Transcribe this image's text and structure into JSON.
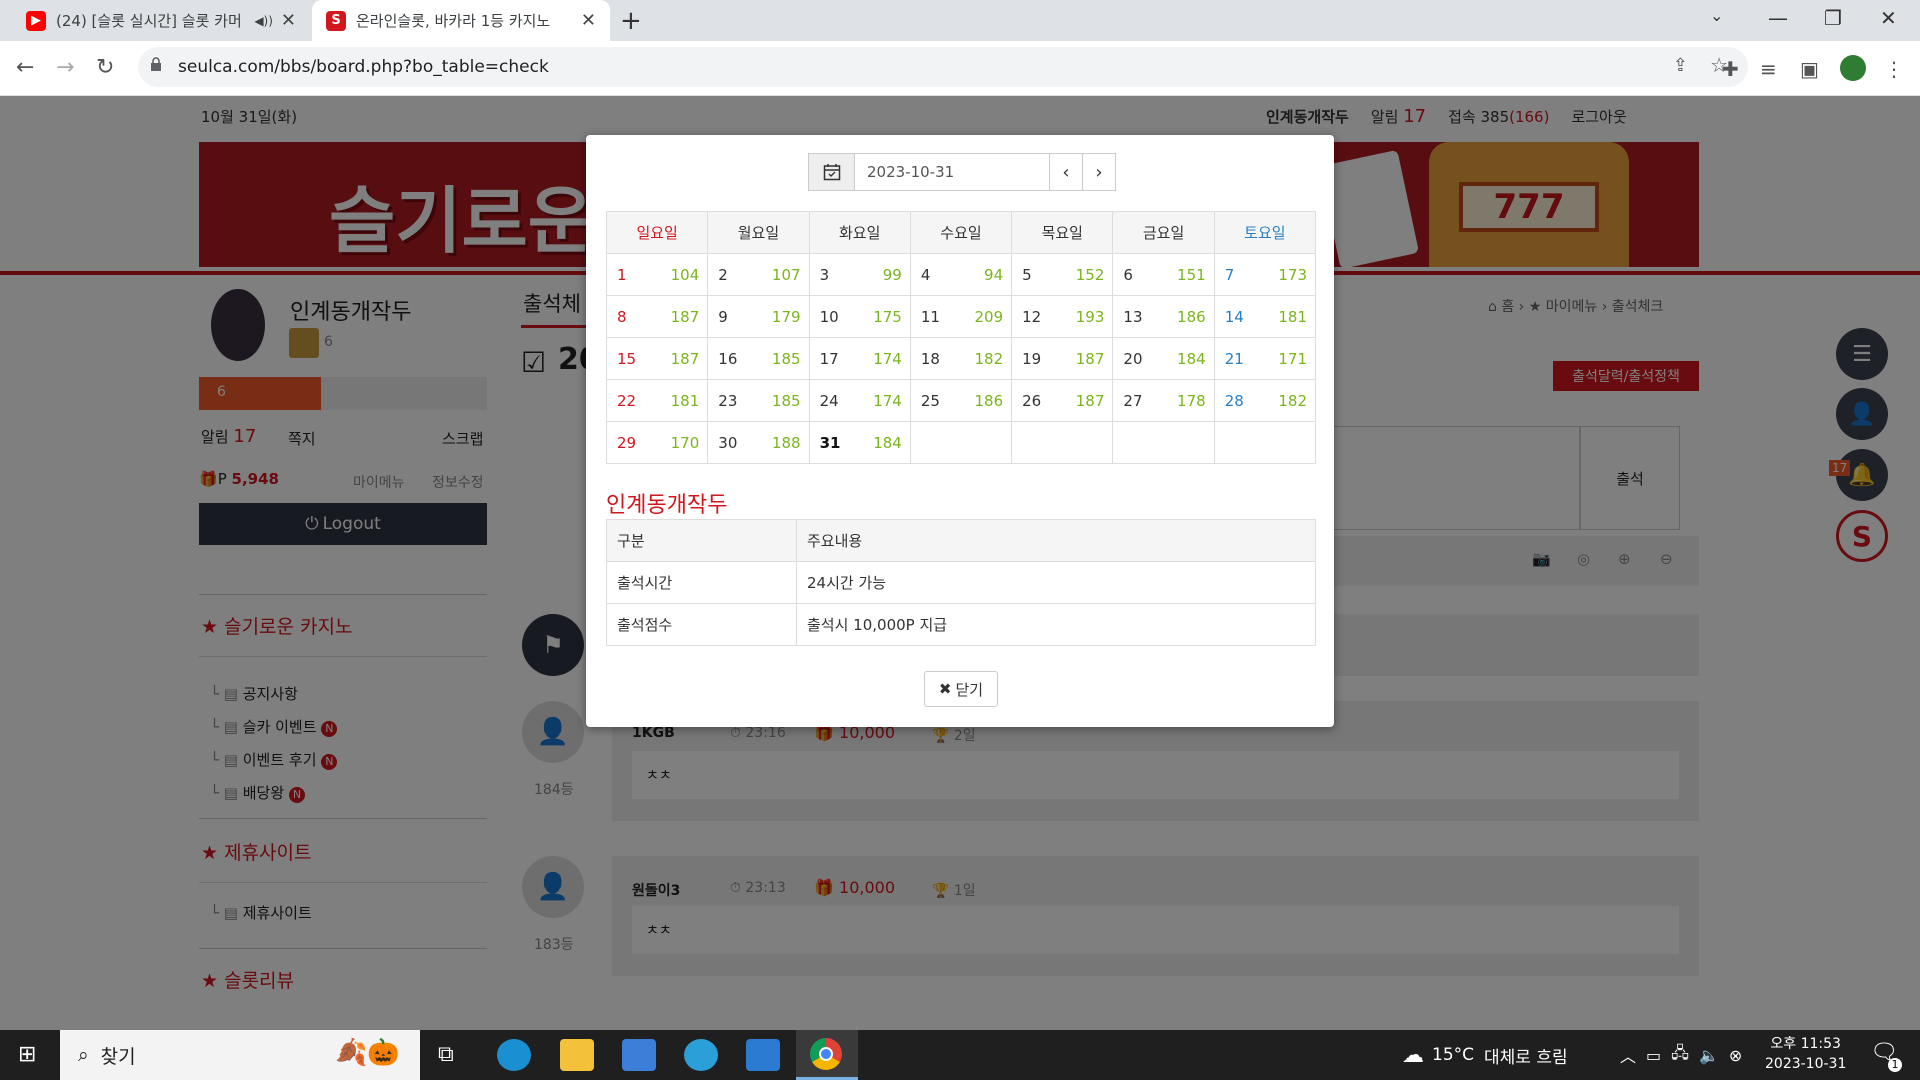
{
  "browser": {
    "tabs": [
      {
        "title": "(24) [슬롯 실시간] 슬롯 카머",
        "close": "✕"
      },
      {
        "title": "온라인슬롯, 바카라 1등 카지노",
        "close": "✕"
      }
    ],
    "new_tab": "+",
    "url": "seulca.com/bbs/board.php?bo_table=check"
  },
  "header": {
    "date": "10월 31일(화)",
    "user": "인계동개작두",
    "alarm_label": "알림",
    "alarm_count": "17",
    "visits_label": "접속 385",
    "visits_paren": "(166)",
    "logout": "로그아웃"
  },
  "banner": {
    "text": "슬기로운"
  },
  "profile": {
    "name": "인계동개작두",
    "level": "6",
    "bar_level": "6",
    "alarm_label": "알림",
    "alarm_count": "17",
    "memo": "쪽지",
    "scrap": "스크랩",
    "points_prefix": "P",
    "points": "5,948",
    "mymenu": "마이메뉴",
    "edit": "정보수정",
    "logout": "Logout"
  },
  "sidebar": {
    "sections": [
      {
        "title": "슬기로운 카지노",
        "items": [
          "공지사항",
          "슬카 이벤트",
          "이벤트 후기",
          "배당왕"
        ]
      },
      {
        "title": "제휴사이트",
        "items": [
          "제휴사이트"
        ]
      },
      {
        "title": "슬롯리뷰",
        "items": []
      }
    ],
    "new_badge": "N"
  },
  "main": {
    "heading": "출석체",
    "year_partial": "20",
    "breadcrumb": [
      "홈",
      "마이메뉴",
      "출석체크"
    ],
    "policy_button": "출석달력/출석정책",
    "checkin_button": "출석",
    "posts": [
      {
        "rank": "184등",
        "author": "1KGB",
        "time": "23:16",
        "points": "10,000",
        "days": "2일",
        "content": "ㅊㅊ"
      },
      {
        "rank": "183등",
        "author": "원돌이3",
        "time": "23:13",
        "points": "10,000",
        "days": "1일",
        "content": "ㅊㅊ"
      }
    ],
    "bell_count": "17"
  },
  "modal": {
    "date_value": "2023-10-31",
    "weekdays": [
      "일요일",
      "월요일",
      "화요일",
      "수요일",
      "목요일",
      "금요일",
      "토요일"
    ],
    "weeks": [
      [
        [
          "1",
          "104"
        ],
        [
          "2",
          "107"
        ],
        [
          "3",
          "99"
        ],
        [
          "4",
          "94"
        ],
        [
          "5",
          "152"
        ],
        [
          "6",
          "151"
        ],
        [
          "7",
          "173"
        ]
      ],
      [
        [
          "8",
          "187"
        ],
        [
          "9",
          "179"
        ],
        [
          "10",
          "175"
        ],
        [
          "11",
          "209"
        ],
        [
          "12",
          "193"
        ],
        [
          "13",
          "186"
        ],
        [
          "14",
          "181"
        ]
      ],
      [
        [
          "15",
          "187"
        ],
        [
          "16",
          "185"
        ],
        [
          "17",
          "174"
        ],
        [
          "18",
          "182"
        ],
        [
          "19",
          "187"
        ],
        [
          "20",
          "184"
        ],
        [
          "21",
          "171"
        ]
      ],
      [
        [
          "22",
          "181"
        ],
        [
          "23",
          "185"
        ],
        [
          "24",
          "174"
        ],
        [
          "25",
          "186"
        ],
        [
          "26",
          "187"
        ],
        [
          "27",
          "178"
        ],
        [
          "28",
          "182"
        ]
      ],
      [
        [
          "29",
          "170"
        ],
        [
          "30",
          "188"
        ],
        [
          "31",
          "184"
        ],
        null,
        null,
        null,
        null
      ]
    ],
    "today": "31",
    "info_title": "인계동개작두",
    "info_headers": [
      "구분",
      "주요내용"
    ],
    "info_rows": [
      [
        "출석시간",
        "24시간 가능"
      ],
      [
        "출석점수",
        "출석시 10,000P 지급"
      ]
    ],
    "close_label": "닫기"
  },
  "taskbar": {
    "search": "찾기",
    "weather_temp": "15°C",
    "weather_desc": "대체로 흐림",
    "time_ampm": "오후 11:53",
    "date": "2023-10-31",
    "notif_count": "1"
  },
  "colors": {
    "accent_red": "#d2161e",
    "green_count": "#7ab51d",
    "sat_blue": "#2a7fc2",
    "dark_nav": "#2f3542"
  }
}
